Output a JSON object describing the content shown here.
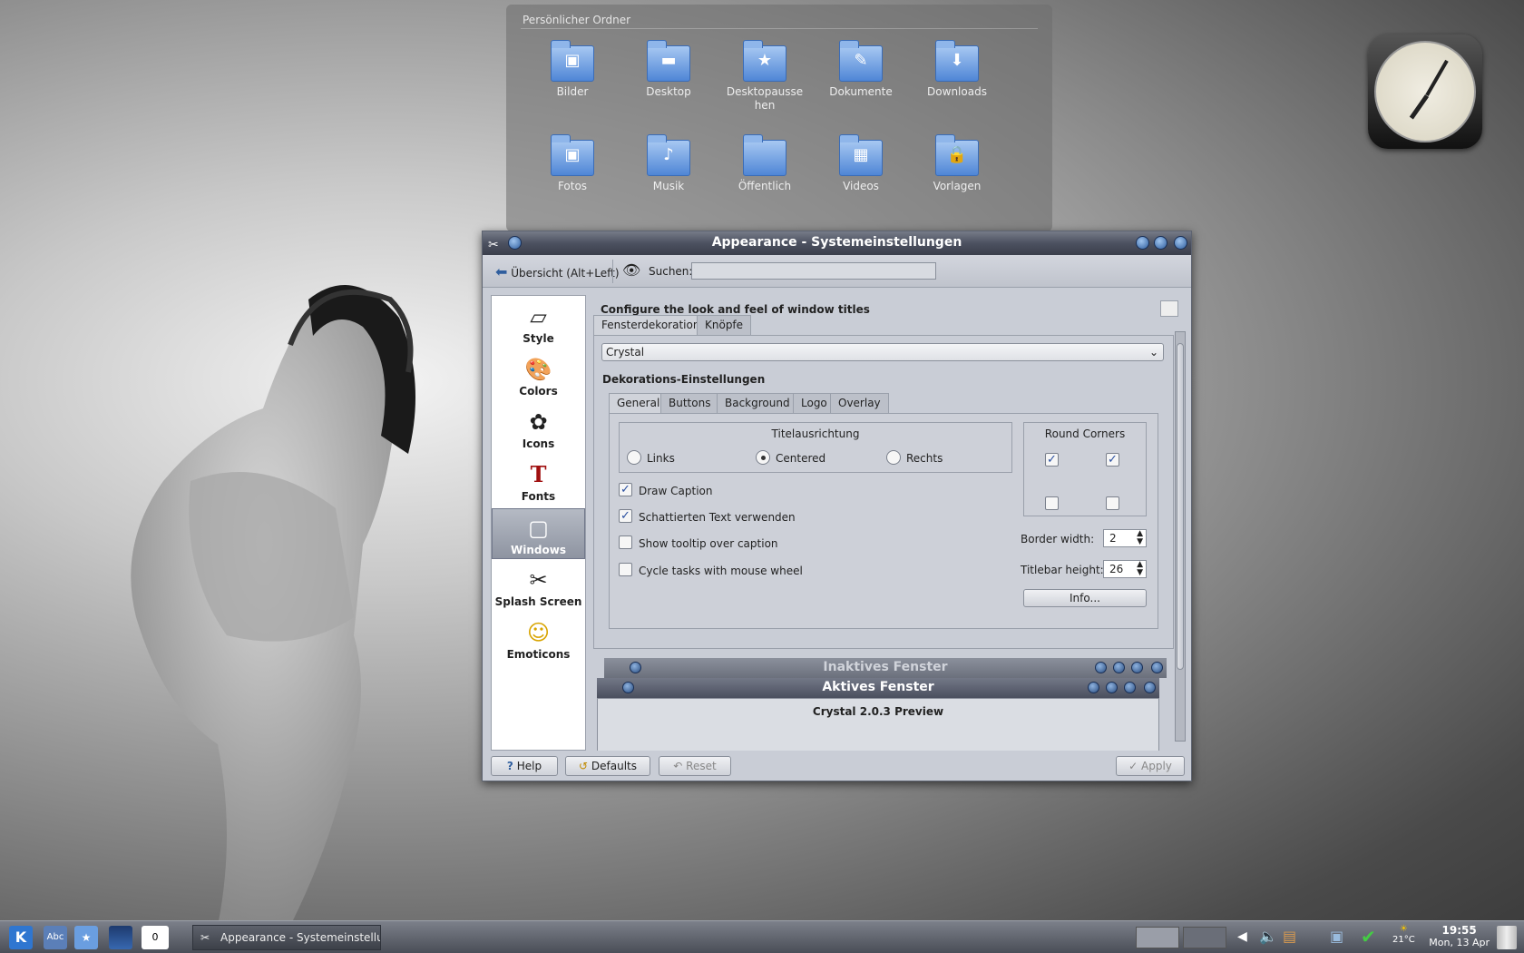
{
  "folderview": {
    "title": "Persönlicher Ordner",
    "items": [
      {
        "label": "Bilder",
        "glyph": "▣"
      },
      {
        "label": "Desktop",
        "glyph": "▬"
      },
      {
        "label": "Desktopausse hen",
        "glyph": "★"
      },
      {
        "label": "Dokumente",
        "glyph": "✎"
      },
      {
        "label": "Downloads",
        "glyph": "⬇"
      },
      {
        "label": "Fotos",
        "glyph": "▣"
      },
      {
        "label": "Musik",
        "glyph": "♪"
      },
      {
        "label": "Öffentlich",
        "glyph": ""
      },
      {
        "label": "Videos",
        "glyph": "▦"
      },
      {
        "label": "Vorlagen",
        "glyph": "🔒"
      }
    ]
  },
  "window": {
    "title": "Appearance - Systemeinstellungen",
    "back_label": "Übersicht (Alt+Left)",
    "search_label": "Suchen:",
    "search_value": "",
    "heading": "Configure the look and feel of window titles"
  },
  "sidebar": {
    "items": [
      {
        "label": "Style",
        "icon": "style-icon",
        "glyph": "▱"
      },
      {
        "label": "Colors",
        "icon": "colors-icon",
        "glyph": "🎨"
      },
      {
        "label": "Icons",
        "icon": "icons-icon",
        "glyph": "✿"
      },
      {
        "label": "Fonts",
        "icon": "fonts-icon",
        "glyph": "T"
      },
      {
        "label": "Windows",
        "icon": "windows-icon",
        "glyph": "▢"
      },
      {
        "label": "Splash Screen",
        "icon": "splash-icon",
        "glyph": "✂"
      },
      {
        "label": "Emoticons",
        "icon": "emoticons-icon",
        "glyph": "☺"
      }
    ],
    "active_index": 4
  },
  "tabs": {
    "outer": [
      "Fensterdekoration",
      "Knöpfe"
    ],
    "inner": [
      "General",
      "Buttons",
      "Background",
      "Logo",
      "Overlay"
    ]
  },
  "decoration": {
    "selected": "Crystal",
    "settings_label": "Dekorations-Einstellungen"
  },
  "general": {
    "title_align_label": "Titelausrichtung",
    "align_options": [
      "Links",
      "Centered",
      "Rechts"
    ],
    "align_selected": "Centered",
    "round_corners_label": "Round Corners",
    "checkboxes": [
      {
        "label": "Draw Caption",
        "checked": true
      },
      {
        "label": "Schattierten Text verwenden",
        "checked": true
      },
      {
        "label": "Show tooltip over caption",
        "checked": false
      },
      {
        "label": "Cycle tasks with mouse wheel",
        "checked": false
      }
    ],
    "border_width_label": "Border width:",
    "border_width_value": "2",
    "titlebar_height_label": "Titlebar height:",
    "titlebar_height_value": "26",
    "info_label": "Info..."
  },
  "preview": {
    "inactive_title": "Inaktives Fenster",
    "active_title": "Aktives Fenster",
    "body_text": "Crystal 2.0.3 Preview"
  },
  "footer": {
    "help": "Help",
    "defaults": "Defaults",
    "reset": "Reset",
    "apply": "Apply"
  },
  "taskbar": {
    "pager_label": "0",
    "task_label": "Appearance - Systemeinstellungen",
    "weather": "21°C",
    "time": "19:55",
    "date": "Mon, 13 Apr"
  },
  "colors": {
    "accent": "#2f5e9e",
    "window_bg": "#c9cdd6"
  }
}
